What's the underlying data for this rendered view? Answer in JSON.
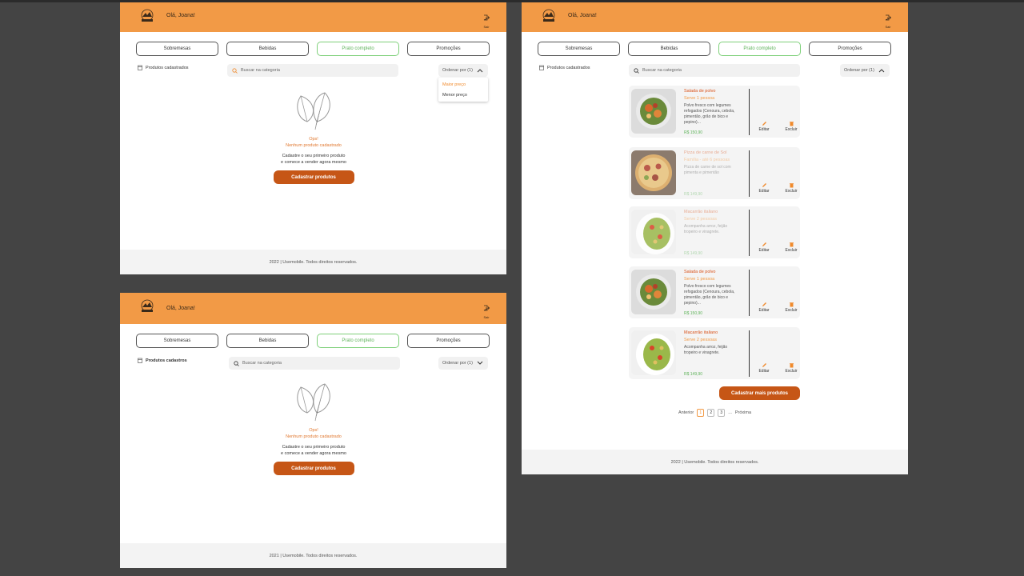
{
  "colors": {
    "header": "#f29a46",
    "primary_button": "#c65616",
    "active_tab": "#5fb35a",
    "accent_text": "#e07830",
    "price": "#5fb35a"
  },
  "header": {
    "greeting": "Olá, Joana!",
    "exit_label": "Sair"
  },
  "tabs": [
    {
      "label": "Sobremesas"
    },
    {
      "label": "Bebidas"
    },
    {
      "label": "Prato completo",
      "active": true
    },
    {
      "label": "Promoções"
    }
  ],
  "sidebar": {
    "label_a": "Produtos cadastrados",
    "label_b": "Produtos cadastros"
  },
  "search": {
    "placeholder": "Buscar na categoria"
  },
  "sort": {
    "label": "Ordenar por (1)",
    "options": [
      "Maior preço",
      "Menor preço"
    ]
  },
  "empty_state": {
    "oops": "Ops!",
    "message": "Nenhum produto cadastrado",
    "line1": "Cadastre o seu primeiro produto",
    "line2": "e comece a vender agora mesmo",
    "button": "Cadastrar produtos"
  },
  "footer": {
    "text_2022": "2022 | Usemobile. Todos direitos reservados.",
    "text_2021": "2021 | Usemobile. Todos direitos reservados."
  },
  "products": [
    {
      "title": "Salada  de polvo",
      "serves": "Serve 1 pessoa",
      "description": "Polvo fresco com legumes refogados (Cenoura, cebola, pimentão, grão de bico e pepino)...",
      "price": "R$ 150,90",
      "image": "octopus-salad-bowl"
    },
    {
      "title": "Pizza de carne de Sol",
      "serves": "Família - até 6 pessoas",
      "description": "Pizza de carne de sol com pimenta e pimentão",
      "price": "R$ 149,90",
      "image": "pizza"
    },
    {
      "title": "Macarrão italiano",
      "serves": "Serve 2 pessoas",
      "description": "Acompanha arroz, feijão tropeiro e vinagrete.",
      "price": "R$ 149,90",
      "image": "pasta-salad"
    },
    {
      "title": "Salada  de polvo",
      "serves": "Serve 1 pessoa",
      "description": "Polvo fresco com legumes refogados (Cenoura, cebola, pimentão, grão de bico e pepino)...",
      "price": "R$ 150,90",
      "image": "octopus-salad-bowl"
    },
    {
      "title": "Macarrão italiano",
      "serves": "Serve 2 pessoas",
      "description": "Acompanha arroz, feijão tropeiro e vinagrete.",
      "price": "R$ 149,90",
      "image": "pasta-salad"
    }
  ],
  "actions": {
    "edit": "Editar",
    "delete": "Excluir"
  },
  "more_button": "Cadastrar mais produtos",
  "pagination": {
    "prev": "Anterior",
    "pages": [
      "1",
      "2",
      "3"
    ],
    "ellipsis": "...",
    "next": "Próxima",
    "current": 1
  }
}
